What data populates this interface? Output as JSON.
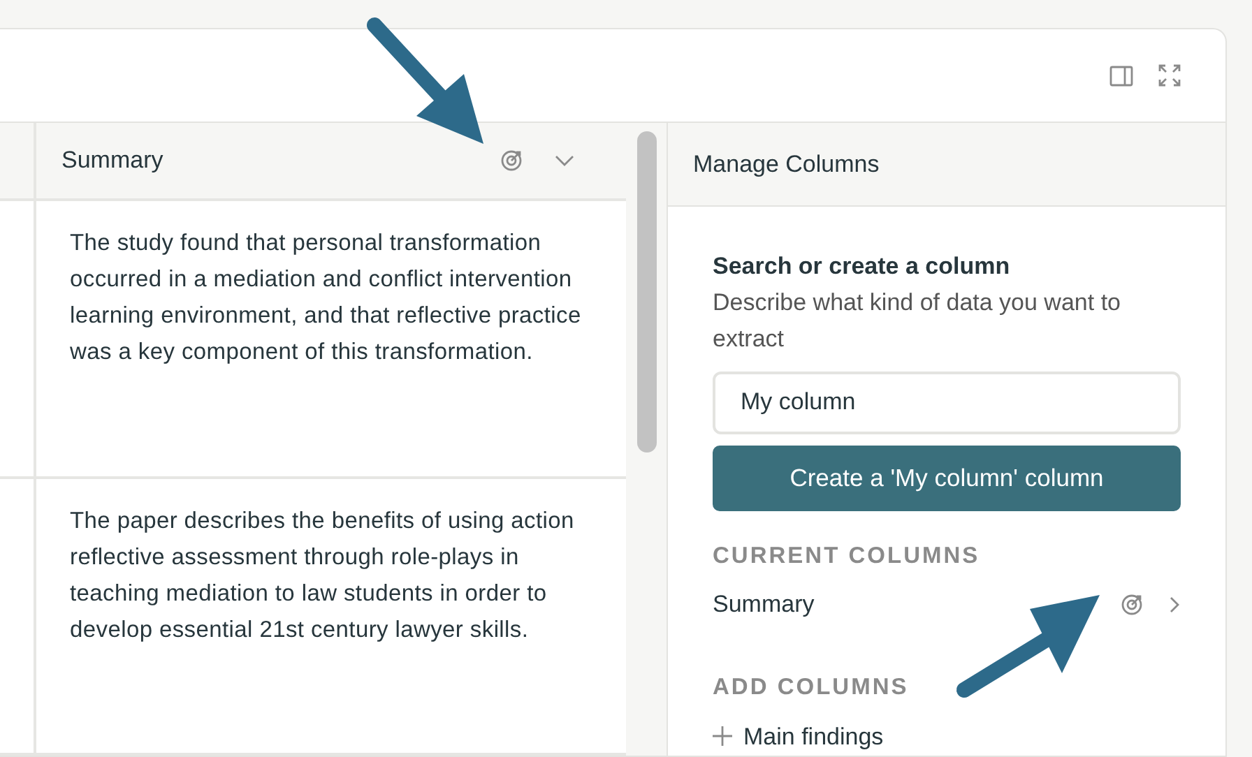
{
  "table": {
    "columns": [
      {
        "label": "Summary"
      }
    ],
    "rows": [
      {
        "summary": "The study found that personal transformation occurred in a mediation and conflict intervention learning environment, and that reflective practice was a key component of this transformation."
      },
      {
        "summary": "The paper describes the benefits of using action reflective assessment through role-plays in teaching mediation to law students in order to develop essential 21st century lawyer skills."
      }
    ]
  },
  "panel": {
    "title": "Manage Columns",
    "search_title": "Search or create a column",
    "search_hint": "Describe what kind of data you want to extract",
    "field_value": "My column",
    "create_button": "Create a 'My column' column",
    "current_heading": "CURRENT COLUMNS",
    "current_columns": [
      {
        "label": "Summary"
      }
    ],
    "add_heading": "ADD COLUMNS",
    "add_columns": [
      {
        "label": "Main findings"
      }
    ]
  }
}
